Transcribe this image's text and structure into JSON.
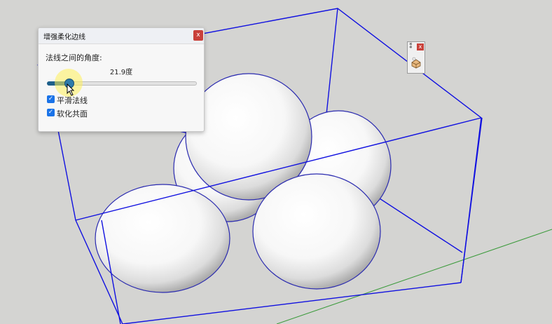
{
  "dialog": {
    "title": "增强柔化边线",
    "close_glyph": "x",
    "angle_label": "法线之间的角度:",
    "angle_value": "21.9度",
    "slider_fraction": 0.145,
    "checkboxes": [
      {
        "label": "平滑法线",
        "checked": true
      },
      {
        "label": "软化共面",
        "checked": true
      }
    ]
  },
  "toolbar": {
    "grip_glyph": "⁑",
    "close_glyph": "x",
    "icon": "soften-edges-tool-icon"
  },
  "scene": {
    "background_color": "#d4d4d2",
    "box_edge_color": "#1010e0",
    "sphere_outline_color": "#2a2ab0",
    "axis_color": "#3a9a3a",
    "object_count_spheres": 5
  }
}
